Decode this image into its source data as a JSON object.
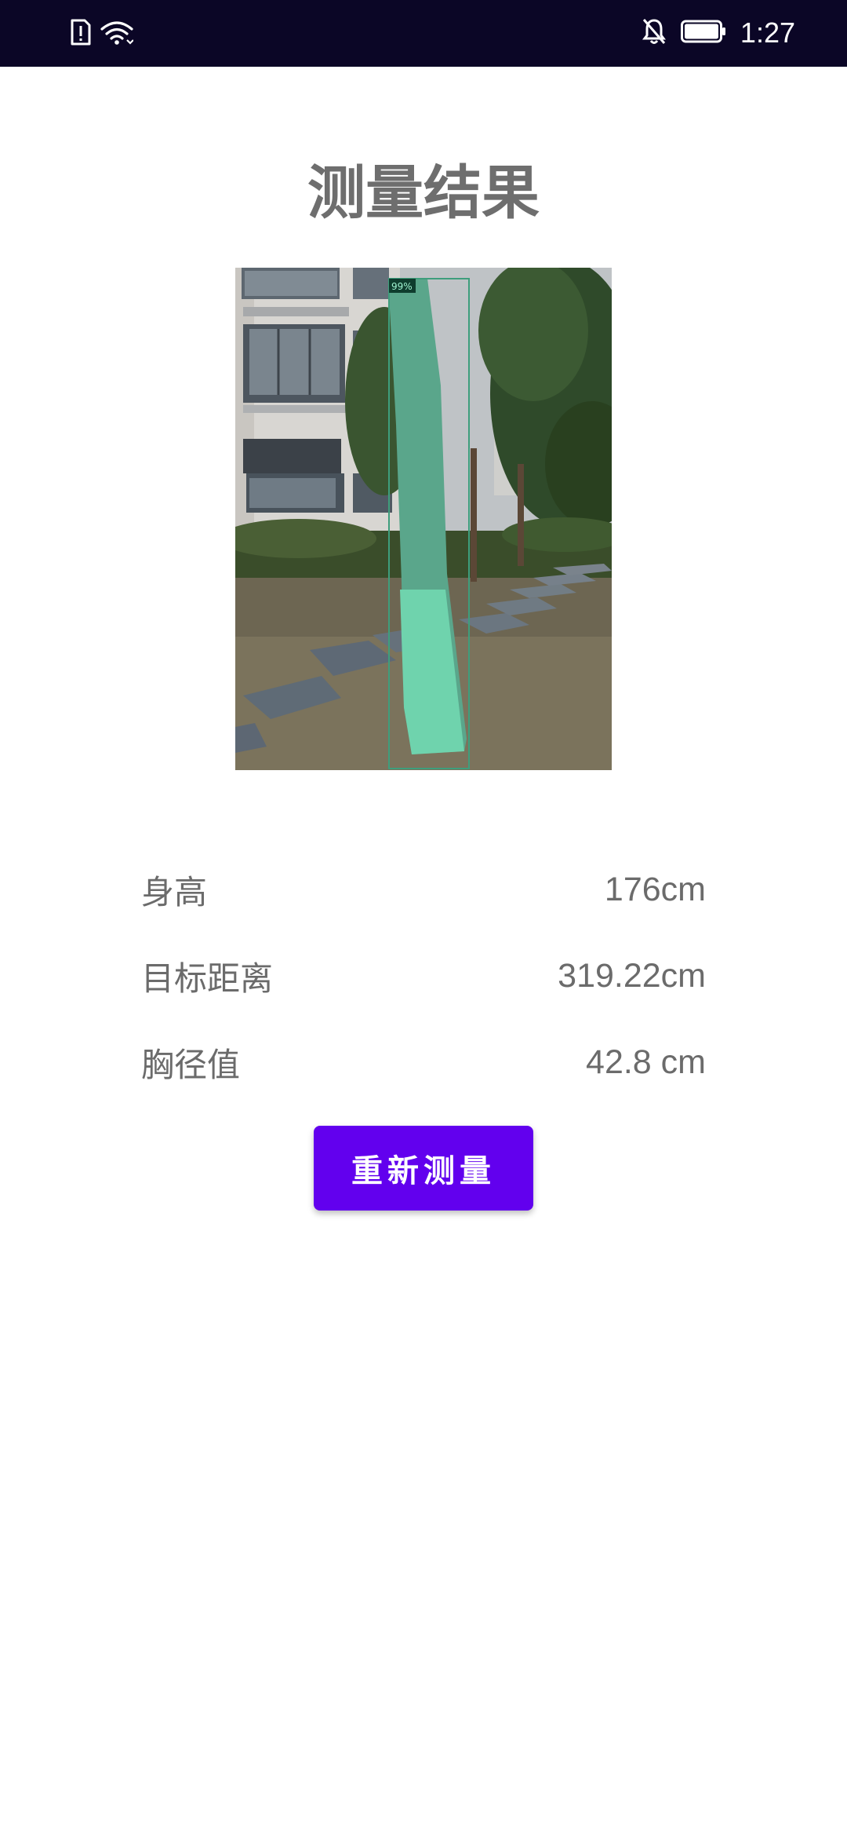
{
  "status_bar": {
    "time": "1:27",
    "left_icons": [
      "sim-alert-icon",
      "wifi-icon"
    ],
    "right_icons": [
      "notifications-off-icon",
      "battery-icon"
    ]
  },
  "page": {
    "title": "测量结果"
  },
  "photo": {
    "detection_label": "99%"
  },
  "results": [
    {
      "label": "身高",
      "value": "176cm"
    },
    {
      "label": "目标距离",
      "value": "319.22cm"
    },
    {
      "label": "胸径值",
      "value": "42.8 cm"
    }
  ],
  "actions": {
    "remeasure_label": "重新测量",
    "accent_color": "#6200ee"
  }
}
